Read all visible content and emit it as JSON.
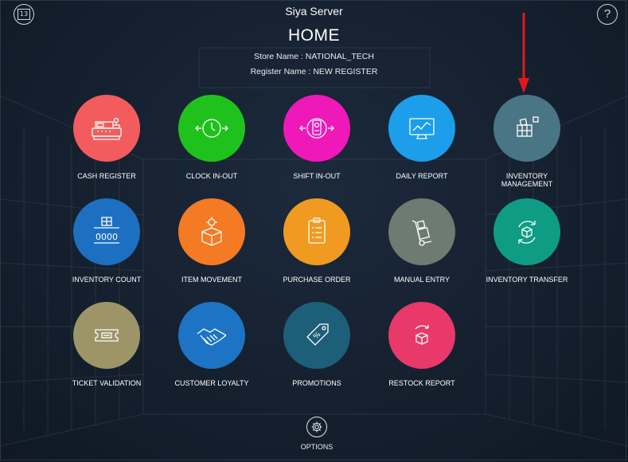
{
  "header": {
    "calendar_day": "13",
    "server_name": "Siya Server",
    "page_title": "HOME",
    "store_line": "Store Name : NATIONAL_TECH",
    "register_line": "Register Name : NEW REGISTER",
    "help_symbol": "?"
  },
  "tiles": [
    {
      "label": "CASH REGISTER",
      "color": "#f25c5c",
      "icon": "cash-register-icon"
    },
    {
      "label": "CLOCK IN-OUT",
      "color": "#1fc21c",
      "icon": "clock-icon"
    },
    {
      "label": "SHIFT IN-OUT",
      "color": "#ef18b8",
      "icon": "shift-icon"
    },
    {
      "label": "DAILY REPORT",
      "color": "#1c9eea",
      "icon": "monitor-chart-icon"
    },
    {
      "label": "INVENTORY MANAGEMENT",
      "label_line1": "INVENTORY",
      "label_line2": "MANAGEMENT",
      "color": "#4a7585",
      "icon": "boxes-icon"
    },
    {
      "label": "INVENTORY COUNT",
      "color": "#1d6fc2",
      "icon": "counter-icon"
    },
    {
      "label": "ITEM MOVEMENT",
      "color": "#f47a23",
      "icon": "box-gear-icon"
    },
    {
      "label": "PURCHASE ORDER",
      "color": "#f09a22",
      "icon": "clipboard-icon"
    },
    {
      "label": "MANUAL ENTRY",
      "color": "#6e7b72",
      "icon": "hand-truck-icon"
    },
    {
      "label": "INVENTORY TRANSFER",
      "color": "#0e9d84",
      "icon": "transfer-box-icon"
    },
    {
      "label": "TICKET VALIDATION",
      "color": "#9d9468",
      "icon": "ticket-icon"
    },
    {
      "label": "CUSTOMER LOYALTY",
      "color": "#1d74c4",
      "icon": "handshake-icon"
    },
    {
      "label": "PROMOTIONS",
      "color": "#1d5e78",
      "icon": "price-tag-icon"
    },
    {
      "label": "RESTOCK REPORT",
      "color": "#e8396a",
      "icon": "restock-box-icon"
    }
  ],
  "options": {
    "label": "OPTIONS",
    "icon": "gear-icon"
  },
  "annotation": {
    "arrow_color": "#e0191b"
  }
}
